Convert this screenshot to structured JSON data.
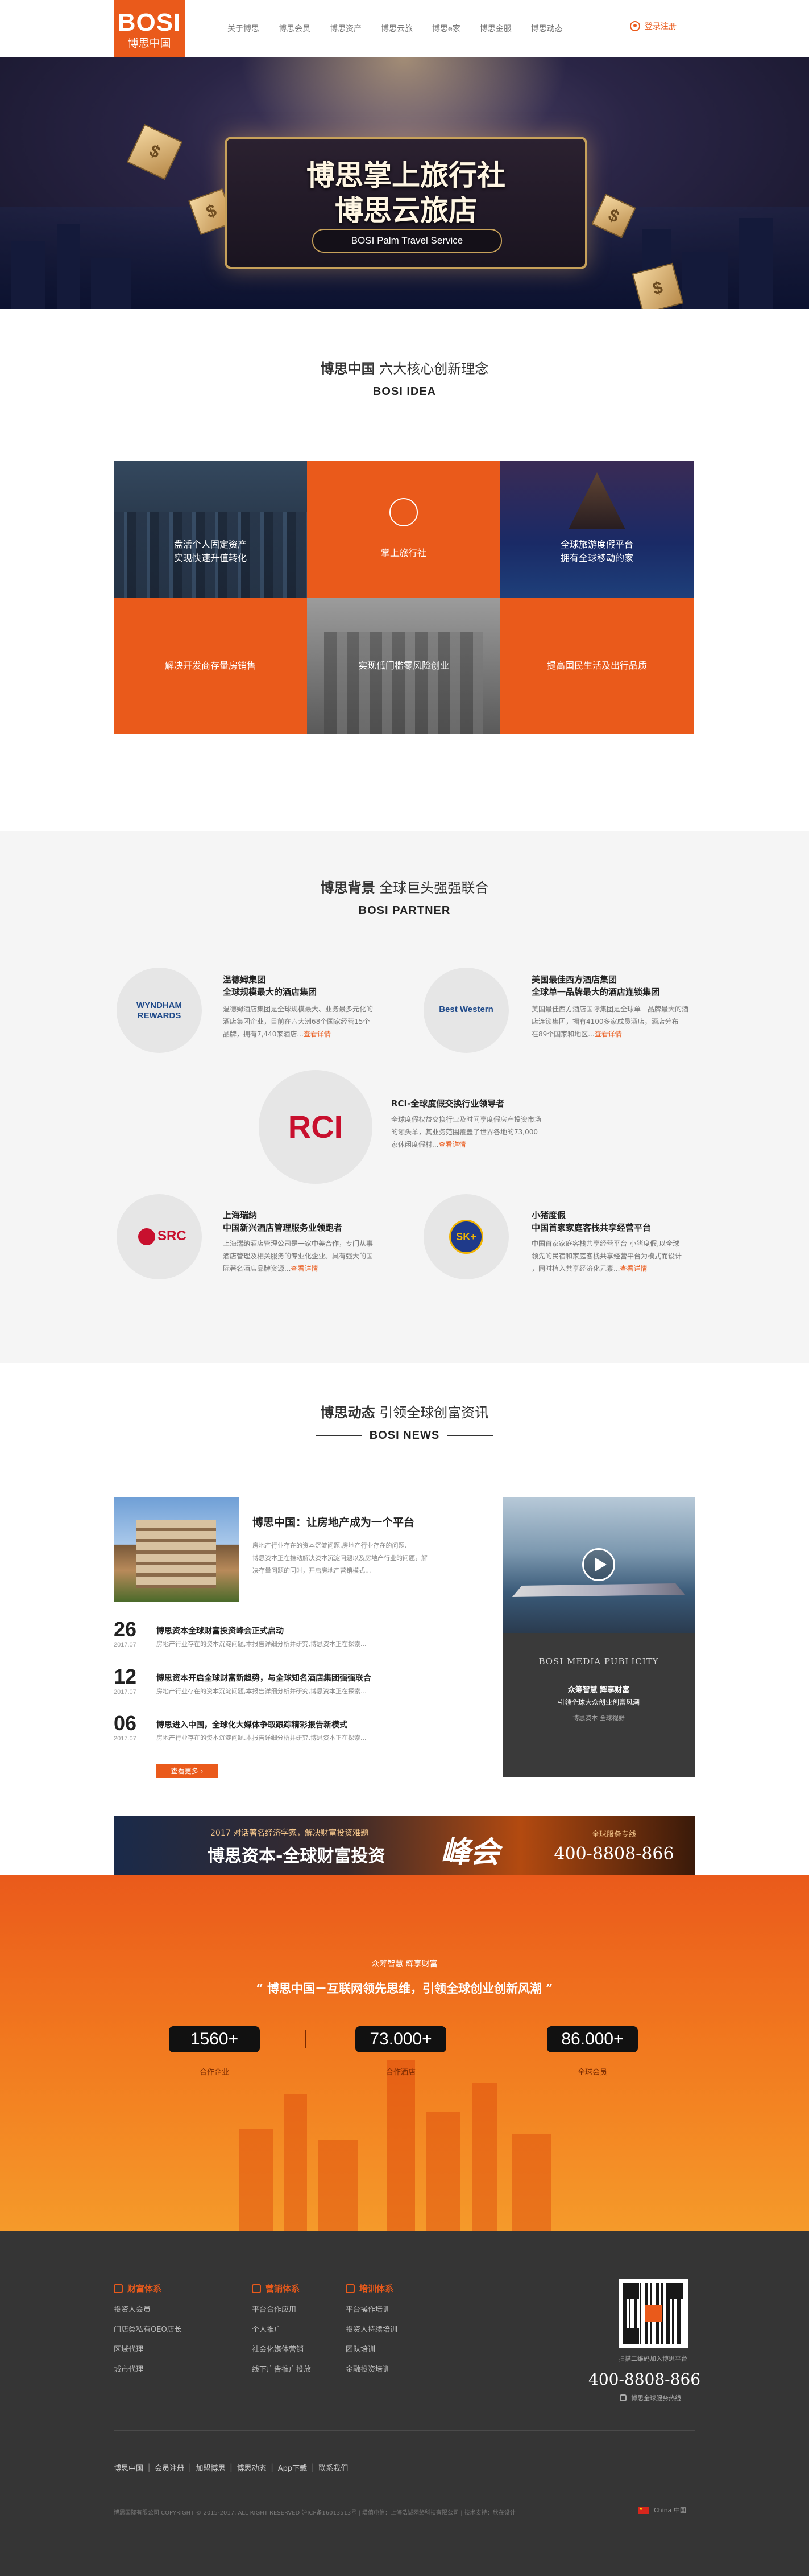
{
  "colors": {
    "brand": "#ea5a1b",
    "footer_bg": "#353535",
    "partner_bg": "#f5f5f5"
  },
  "header": {
    "logo_en": "BOSI",
    "logo_cn": "博思中国",
    "nav": [
      "关于博思",
      "博思会员",
      "博思资产",
      "博思云旅",
      "博思e家",
      "博思金服",
      "博思动态"
    ],
    "login_label": "登录注册"
  },
  "banner": {
    "title1": "博思掌上旅行社",
    "title2": "博思云旅店",
    "subtitle": "BOSI Palm Travel Service"
  },
  "idea": {
    "title_bold": "博思中国",
    "title_rest": "六大核心创新理念",
    "title_en": "BOSI IDEA",
    "tiles": [
      {
        "line1": "盘活个人固定资产",
        "line2": "实现快速升值转化"
      },
      {
        "line1": "掌上旅行社",
        "line2": ""
      },
      {
        "line1": "全球旅游度假平台",
        "line2": "拥有全球移动的家"
      },
      {
        "line1": "解决开发商存量房销售",
        "line2": ""
      },
      {
        "line1": "实现低门槛零风险创业",
        "line2": ""
      },
      {
        "line1": "提高国民生活及出行品质",
        "line2": ""
      }
    ]
  },
  "partner": {
    "title_bold": "博思背景",
    "title_rest": "全球巨头强强联合",
    "title_en": "BOSI PARTNER",
    "more_label": "查看详情",
    "items": [
      {
        "logo": "WYNDHAM REWARDS",
        "name1": "温德姆集团",
        "name2": "全球规模最大的酒店集团",
        "desc": [
          "温德姆酒店集团是全球规模最大、业务最多元化的",
          "酒店集团企业，目前在六大洲68个国家经营15个",
          "品牌，拥有7,440家酒店..."
        ]
      },
      {
        "logo": "Best Western",
        "name1": "美国最佳西方酒店集团",
        "name2": "全球单一品牌最大的酒店连锁集团",
        "desc": [
          "美国最佳西方酒店国际集团是全球单一品牌最大的酒",
          "店连锁集团，拥有4100多家成员酒店，酒店分布",
          "在89个国家和地区..."
        ]
      },
      {
        "logo": "RCI",
        "name1": "RCI-全球度假交换行业领导者",
        "name2": "",
        "desc": [
          "全球度假权益交换行业及时间享度假房产投资市场",
          "的领头羊，其业务范围覆盖了世界各地的73,000",
          "家休闲度假村..."
        ]
      },
      {
        "logo": "SRC",
        "name1": "上海瑞纳",
        "name2": "中国新兴酒店管理服务业领跑者",
        "desc": [
          "上海瑞纳酒店管理公司是一家中美合作，专门从事",
          "酒店管理及相关服务的专业化企业。具有强大的国",
          "际著名酒店品牌资源..."
        ]
      },
      {
        "logo": "SK+",
        "name1": "小猪度假",
        "name2": "中国首家家庭客栈共享经营平台",
        "desc": [
          "中国首家家庭客栈共享经营平台-小猪度假,以全球",
          "领先的民宿和家庭客栈共享经营平台为模式而设计",
          "，同时植入共享经济化元素..."
        ]
      }
    ]
  },
  "news": {
    "title_bold": "博思动态",
    "title_rest": "引领全球创富资讯",
    "title_en": "BOSI NEWS",
    "feature_title": "博思中国：让房地产成为一个平台",
    "feature_desc": [
      "房地产行业存在的资本沉淀问题,房地产行业存在的问题,",
      "博思资本正在推动解决资本沉淀问题以及房地产行业的问题，解",
      "决存量问题的同时，开启房地产营销模式..."
    ],
    "items": [
      {
        "day": "26",
        "ym": "2017.07",
        "title": "博思资本全球财富投资峰会正式启动",
        "desc": "房地产行业存在的资本沉淀问题,本报告详细分析并研究,博思资本正在探索..."
      },
      {
        "day": "12",
        "ym": "2017.07",
        "title": "博思资本开启全球财富新趋势，与全球知名酒店集团强强联合",
        "desc": "房地产行业存在的资本沉淀问题,本报告详细分析并研究,博思资本正在探索..."
      },
      {
        "day": "06",
        "ym": "2017.07",
        "title": "博思进入中国，全球化大媒体争取跟踪精彩报告新模式",
        "desc": "房地产行业存在的资本沉淀问题,本报告详细分析并研究,博思资本正在探索..."
      }
    ],
    "more_label": "查看更多",
    "media_en": "BOSI MEDIA PUBLICITY",
    "media_l1": "众筹智慧 辉享财富",
    "media_l2": "引领全球大众创业创富风潮",
    "media_l3": "博思资本 全球视野",
    "ad_small": "2017 对话著名经济学家，解决财富投资难题",
    "ad_big": "博思资本-全球财富投资",
    "ad_script": "峰会",
    "ad_hotline_label": "全球服务专线",
    "ad_phone": "400-8808-866"
  },
  "band": {
    "slogan": "众筹智慧 辉享财富",
    "headline": "博思中国－互联网领先思维，引领全球创业创新风潮",
    "stats": [
      {
        "value": "1560+",
        "label": "合作企业"
      },
      {
        "value": "73.000+",
        "label": "合作酒店"
      },
      {
        "value": "86.000+",
        "label": "全球会员"
      }
    ]
  },
  "footer": {
    "cols": [
      {
        "title": "财富体系",
        "links": [
          "投资人会员",
          "门店类私有OEO店长",
          "区域代理",
          "城市代理"
        ]
      },
      {
        "title": "营销体系",
        "links": [
          "平台合作应用",
          "个人推广",
          "社会化媒体营销",
          "线下广告推广投放"
        ]
      },
      {
        "title": "培训体系",
        "links": [
          "平台操作培训",
          "投资人持续培训",
          "团队培训",
          "金融投资培训"
        ]
      }
    ],
    "qr_caption": "扫描二维码加入博思平台",
    "phone": "400-8808-866",
    "phone_caption": "博思全球服务热线",
    "links": [
      "博思中国",
      "会员注册",
      "加盟博思",
      "博思动态",
      "App下载",
      "联系我们"
    ],
    "copyright": "博思国际有限公司 COPYRIGHT © 2015-2017, ALL RIGHT RESERVED 沪ICP备16013513号 | 增值电信：上海浩诚网络科技有限公司 | 技术支持：欣在设计",
    "region": "China 中国"
  }
}
